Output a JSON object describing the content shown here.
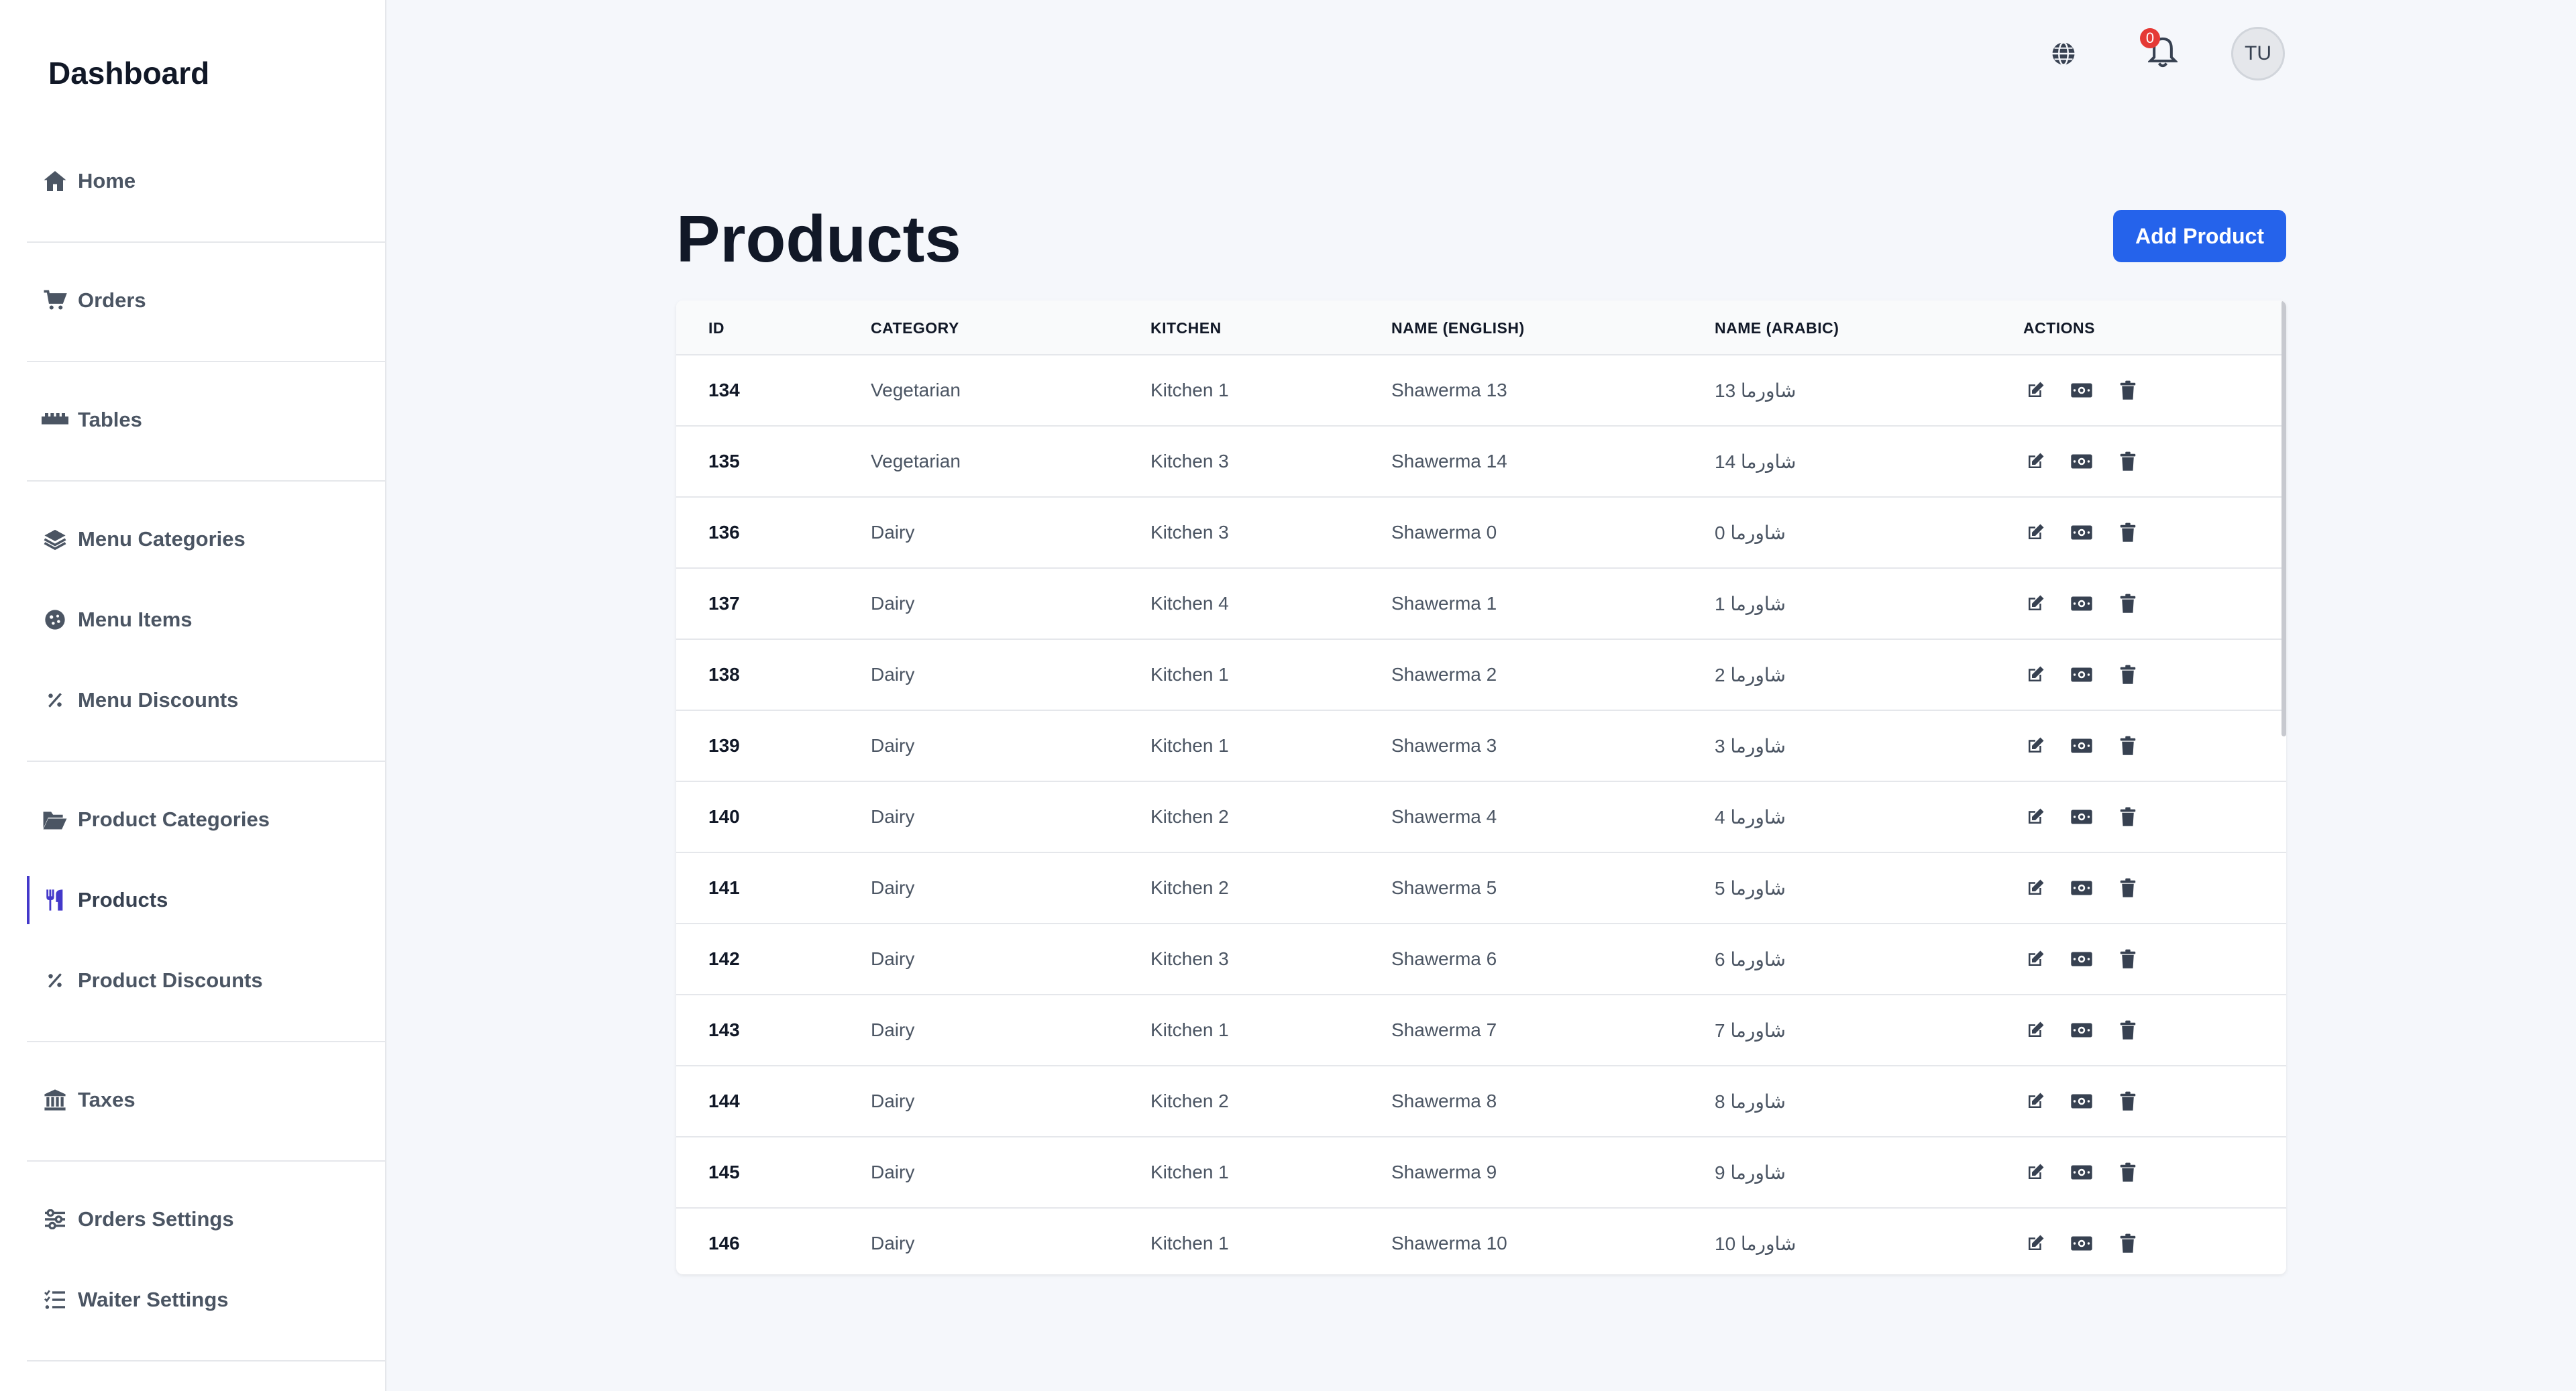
{
  "sidebar": {
    "brand": "Dashboard",
    "items": [
      {
        "label": "Home",
        "icon": "home-icon"
      },
      {
        "label": "Orders",
        "icon": "cart-icon"
      },
      {
        "label": "Tables",
        "icon": "table-icon"
      },
      {
        "label": "Menu Categories",
        "icon": "layers-icon"
      },
      {
        "label": "Menu Items",
        "icon": "cookie-icon"
      },
      {
        "label": "Menu Discounts",
        "icon": "percent-icon"
      },
      {
        "label": "Product Categories",
        "icon": "folder-open-icon"
      },
      {
        "label": "Products",
        "icon": "utensils-icon",
        "active": true
      },
      {
        "label": "Product Discounts",
        "icon": "percent-icon"
      },
      {
        "label": "Taxes",
        "icon": "bank-icon"
      },
      {
        "label": "Orders Settings",
        "icon": "sliders-icon"
      },
      {
        "label": "Waiter Settings",
        "icon": "list-check-icon"
      }
    ]
  },
  "topbar": {
    "notification_count": "0",
    "avatar_initials": "TU"
  },
  "main": {
    "title": "Products",
    "add_button": "Add Product"
  },
  "table": {
    "headers": [
      "ID",
      "CATEGORY",
      "KITCHEN",
      "NAME (ENGLISH)",
      "NAME (ARABIC)",
      "ACTIONS"
    ],
    "rows": [
      {
        "id": "134",
        "category": "Vegetarian",
        "kitchen": "Kitchen 1",
        "name_en": "Shawerma 13",
        "name_ar": "شاورما 13"
      },
      {
        "id": "135",
        "category": "Vegetarian",
        "kitchen": "Kitchen 3",
        "name_en": "Shawerma 14",
        "name_ar": "شاورما 14"
      },
      {
        "id": "136",
        "category": "Dairy",
        "kitchen": "Kitchen 3",
        "name_en": "Shawerma 0",
        "name_ar": "شاورما 0"
      },
      {
        "id": "137",
        "category": "Dairy",
        "kitchen": "Kitchen 4",
        "name_en": "Shawerma 1",
        "name_ar": "شاورما 1"
      },
      {
        "id": "138",
        "category": "Dairy",
        "kitchen": "Kitchen 1",
        "name_en": "Shawerma 2",
        "name_ar": "شاورما 2"
      },
      {
        "id": "139",
        "category": "Dairy",
        "kitchen": "Kitchen 1",
        "name_en": "Shawerma 3",
        "name_ar": "شاورما 3"
      },
      {
        "id": "140",
        "category": "Dairy",
        "kitchen": "Kitchen 2",
        "name_en": "Shawerma 4",
        "name_ar": "شاورما 4"
      },
      {
        "id": "141",
        "category": "Dairy",
        "kitchen": "Kitchen 2",
        "name_en": "Shawerma 5",
        "name_ar": "شاورما 5"
      },
      {
        "id": "142",
        "category": "Dairy",
        "kitchen": "Kitchen 3",
        "name_en": "Shawerma 6",
        "name_ar": "شاورما 6"
      },
      {
        "id": "143",
        "category": "Dairy",
        "kitchen": "Kitchen 1",
        "name_en": "Shawerma 7",
        "name_ar": "شاورما 7"
      },
      {
        "id": "144",
        "category": "Dairy",
        "kitchen": "Kitchen 2",
        "name_en": "Shawerma 8",
        "name_ar": "شاورما 8"
      },
      {
        "id": "145",
        "category": "Dairy",
        "kitchen": "Kitchen 1",
        "name_en": "Shawerma 9",
        "name_ar": "شاورما 9"
      },
      {
        "id": "146",
        "category": "Dairy",
        "kitchen": "Kitchen 1",
        "name_en": "Shawerma 10",
        "name_ar": "شاورما 10"
      }
    ]
  },
  "colors": {
    "accent": "#2563eb",
    "active_indicator": "#4338ca",
    "badge": "#e53935"
  }
}
